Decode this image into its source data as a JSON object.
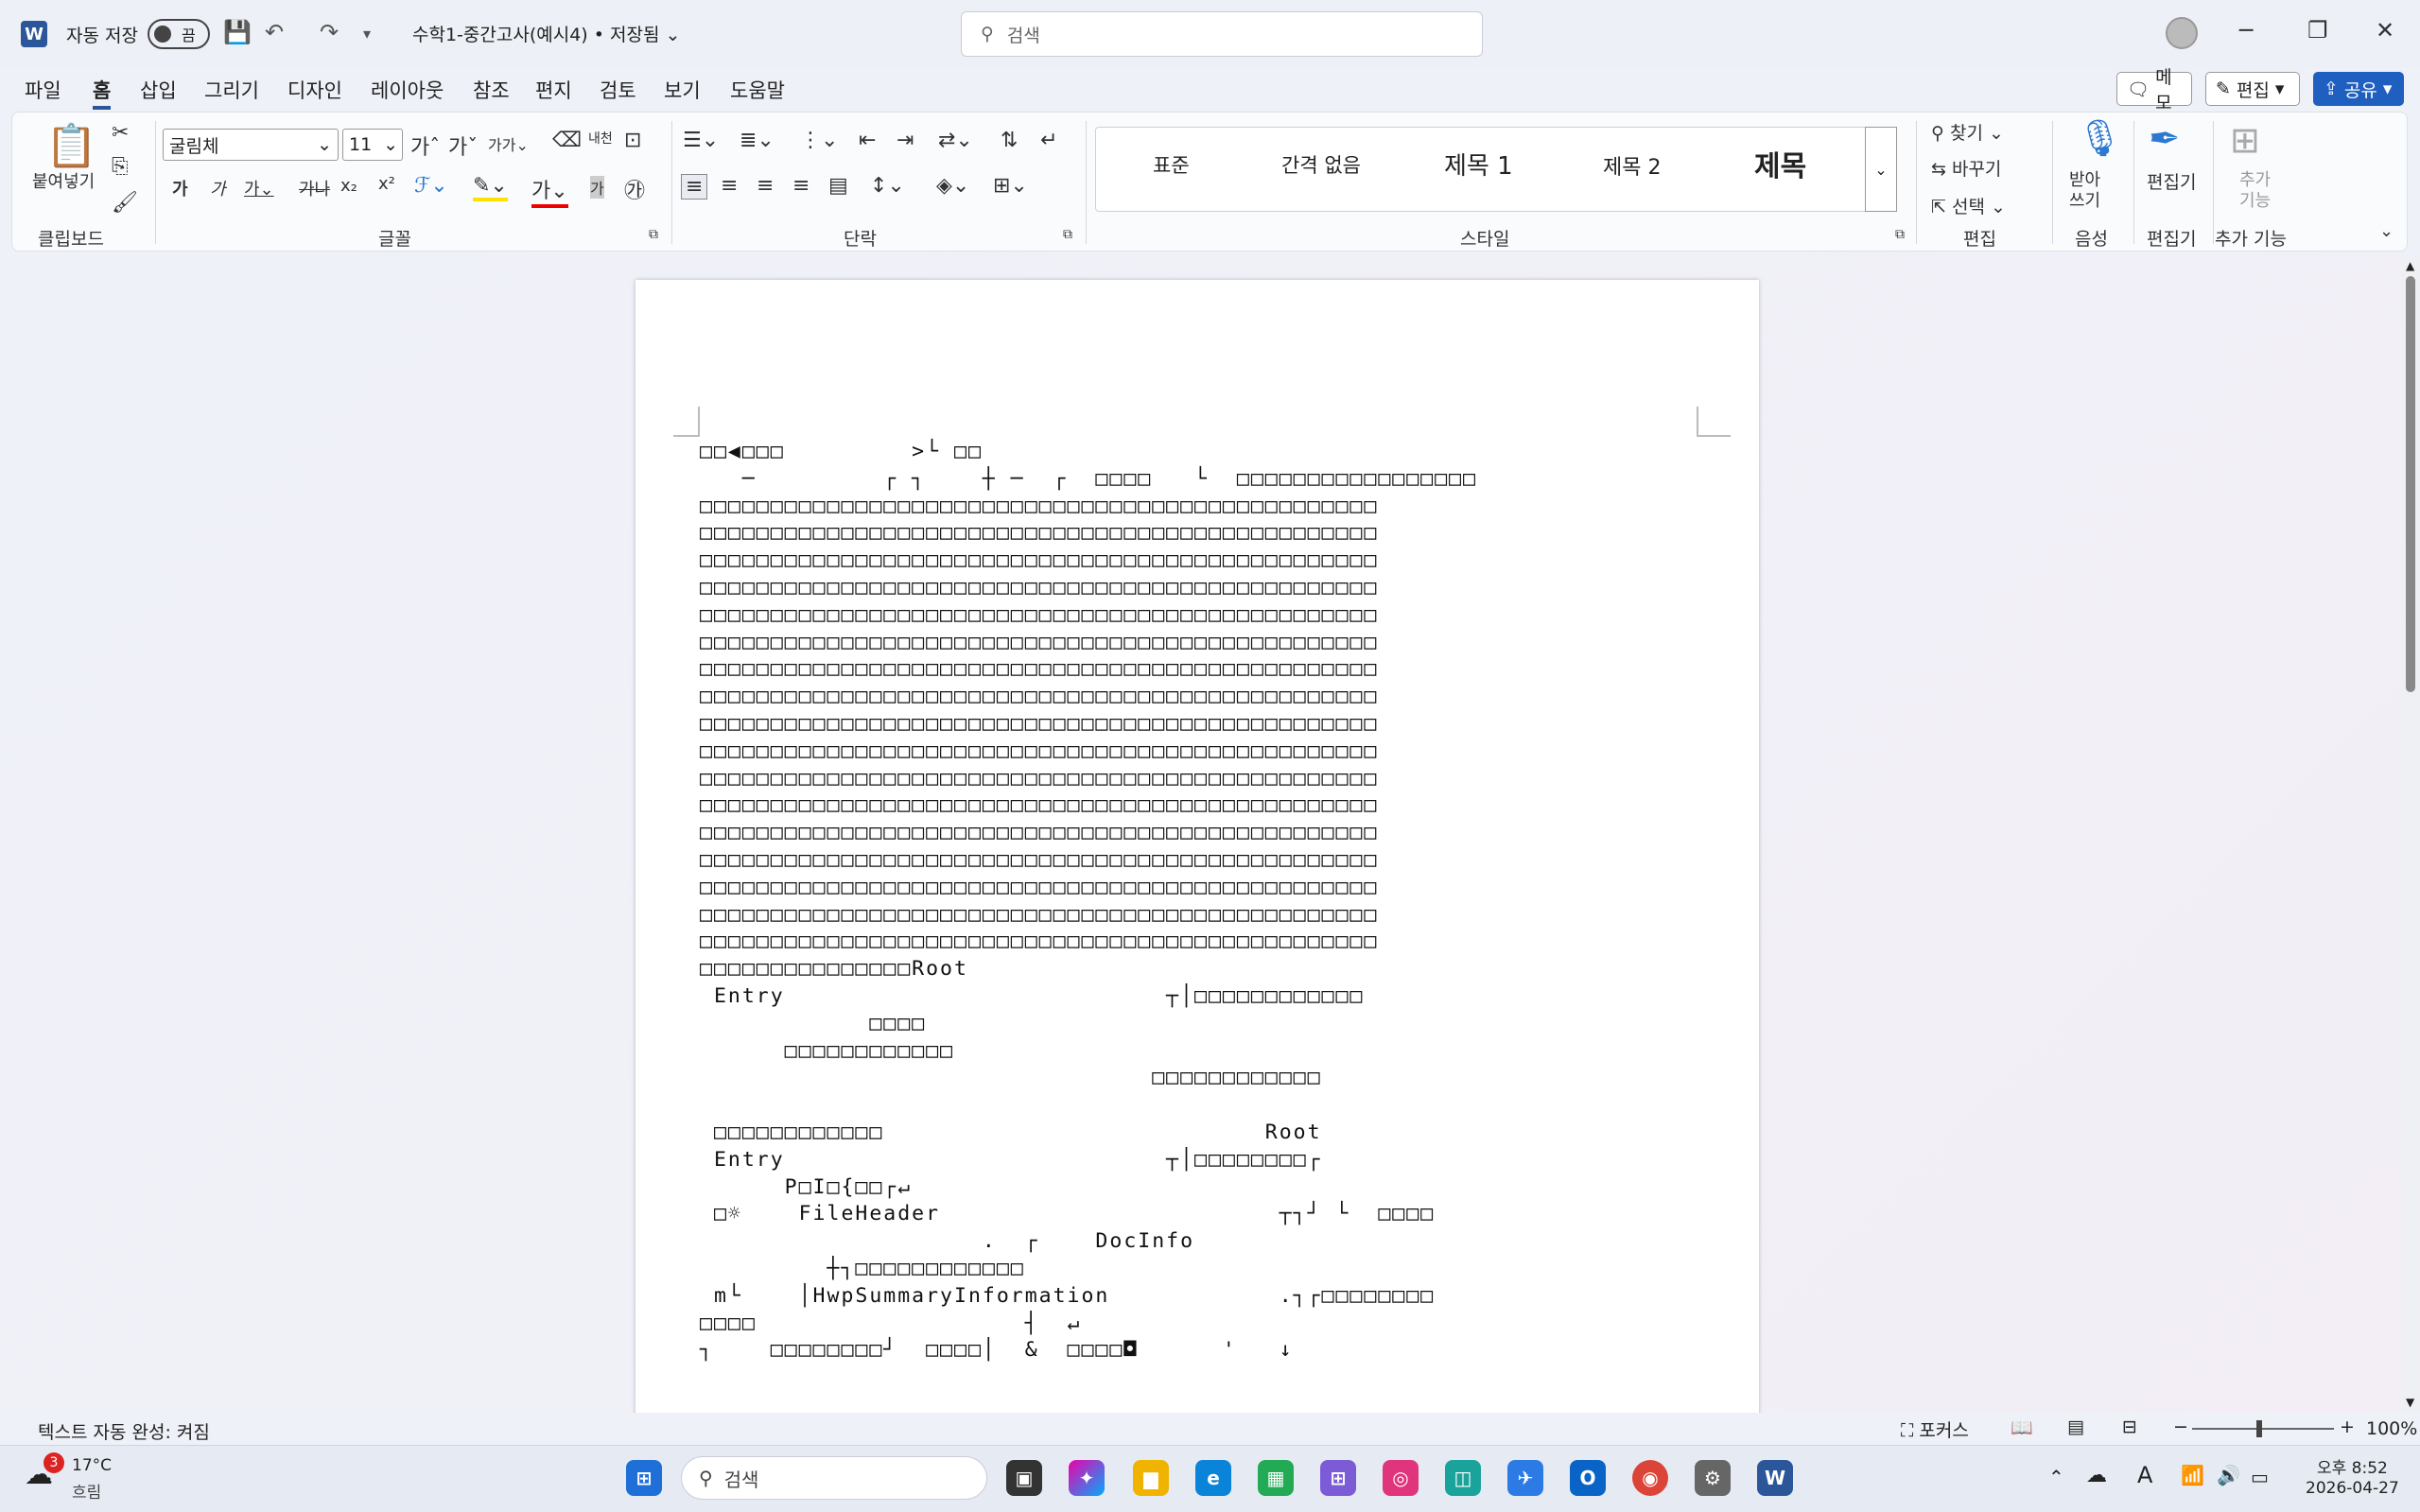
{
  "titlebar": {
    "autosave_label": "자동 저장",
    "autosave_state": "끔",
    "doc_title": "수학1-중간고사(예시4) • 저장됨",
    "search_placeholder": "검색"
  },
  "menu": {
    "tabs": [
      "파일",
      "홈",
      "삽입",
      "그리기",
      "디자인",
      "레이아웃",
      "참조",
      "편지",
      "검토",
      "보기",
      "도움말"
    ],
    "active": "홈",
    "memo": "메모",
    "edit": "편집",
    "share": "공유"
  },
  "ribbon": {
    "paste": "붙여넣기",
    "clipboard": "클립보드",
    "font_name": "굴림체",
    "font_size": "11",
    "font_group": "글꼴",
    "paragraph_group": "단락",
    "styles_group": "스타일",
    "styles": [
      "표준",
      "간격 없음",
      "제목 1",
      "제목 2",
      "제목"
    ],
    "find": "찾기",
    "replace": "바꾸기",
    "select": "선택",
    "edit_group": "편집",
    "dictate": "받아\n쓰기",
    "voice_group": "음성",
    "editor": "편집기",
    "editor_group": "편집기",
    "addins": "추가\n기능",
    "addins_group": "추가 기능"
  },
  "document": {
    "lines": [
      "□□◀□□□         >└ □□",
      "   ─         ┌ ┐    ┼ ─  ┌  □□□□   └  □□□□□□□□□□□□□□□□□",
      "□□□□□□□□□□□□□□□□□□□□□□□□□□□□□□□□□□□□□□□□□□□□□□□□",
      "□□□□□□□□□□□□□□□□□□□□□□□□□□□□□□□□□□□□□□□□□□□□□□□□",
      "□□□□□□□□□□□□□□□□□□□□□□□□□□□□□□□□□□□□□□□□□□□□□□□□",
      "□□□□□□□□□□□□□□□□□□□□□□□□□□□□□□□□□□□□□□□□□□□□□□□□",
      "□□□□□□□□□□□□□□□□□□□□□□□□□□□□□□□□□□□□□□□□□□□□□□□□",
      "□□□□□□□□□□□□□□□□□□□□□□□□□□□□□□□□□□□□□□□□□□□□□□□□",
      "□□□□□□□□□□□□□□□□□□□□□□□□□□□□□□□□□□□□□□□□□□□□□□□□",
      "□□□□□□□□□□□□□□□□□□□□□□□□□□□□□□□□□□□□□□□□□□□□□□□□",
      "□□□□□□□□□□□□□□□□□□□□□□□□□□□□□□□□□□□□□□□□□□□□□□□□",
      "□□□□□□□□□□□□□□□□□□□□□□□□□□□□□□□□□□□□□□□□□□□□□□□□",
      "□□□□□□□□□□□□□□□□□□□□□□□□□□□□□□□□□□□□□□□□□□□□□□□□",
      "□□□□□□□□□□□□□□□□□□□□□□□□□□□□□□□□□□□□□□□□□□□□□□□□",
      "□□□□□□□□□□□□□□□□□□□□□□□□□□□□□□□□□□□□□□□□□□□□□□□□",
      "□□□□□□□□□□□□□□□□□□□□□□□□□□□□□□□□□□□□□□□□□□□□□□□□",
      "□□□□□□□□□□□□□□□□□□□□□□□□□□□□□□□□□□□□□□□□□□□□□□□□",
      "□□□□□□□□□□□□□□□□□□□□□□□□□□□□□□□□□□□□□□□□□□□□□□□□",
      "□□□□□□□□□□□□□□□□□□□□□□□□□□□□□□□□□□□□□□□□□□□□□□□□",
      "□□□□□□□□□□□□□□□Root",
      " Entry                           ┬│□□□□□□□□□□□□",
      "            □□□□",
      "      □□□□□□□□□□□□",
      "                                □□□□□□□□□□□□",
      "",
      " □□□□□□□□□□□□                           Root",
      " Entry                           ┬│□□□□□□□□┌",
      "      P□I□{□□┌↵",
      " □☼    FileHeader                        ┬┐┘ └  □□□□",
      "                    .  ┌    DocInfo",
      "         ┼┐□□□□□□□□□□□□",
      " m└    │HwpSummaryInformation            .┐┌□□□□□□□□",
      "□□□□                   ┤  ↵",
      "┐    □□□□□□□□┘  □□□□│  &  □□□□◘      '   ↓"
    ]
  },
  "status": {
    "autocomplete": "텍스트 자동 완성: 켜짐",
    "focus": "포커스",
    "zoom": "100%"
  },
  "taskbar": {
    "weather_temp": "17°C",
    "weather_desc": "흐림",
    "weather_badge": "3",
    "search": "검색",
    "time": "오후 8:52",
    "date": "2026-04-27"
  }
}
